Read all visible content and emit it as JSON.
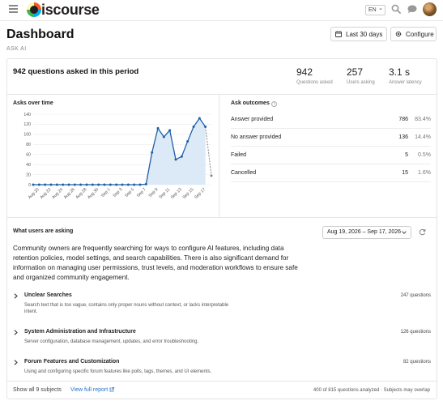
{
  "header": {
    "logo_text": "iscourse",
    "language": "EN"
  },
  "page": {
    "title": "Dashboard",
    "subtitle": "ASK AI",
    "period_button": "Last 30 days",
    "config_button": "Configure"
  },
  "overview": {
    "heading": "942 questions asked in this period",
    "stats": [
      {
        "value": "942",
        "label": "Questions asked"
      },
      {
        "value": "257",
        "label": "Users asking"
      },
      {
        "value": "3.1 s",
        "label": "Answer latency"
      }
    ]
  },
  "asks_over_time": {
    "title": "Asks over time"
  },
  "chart_data": {
    "type": "line",
    "title": "Asks over time",
    "xlabel": "",
    "ylabel": "",
    "ylim": [
      0,
      140
    ],
    "yticks": [
      0,
      20,
      40,
      60,
      80,
      100,
      120,
      140
    ],
    "x_tick_labels": [
      "Aug 20",
      "Aug 22",
      "Aug 24",
      "Aug 26",
      "Aug 28",
      "Aug 30",
      "Sep 1",
      "Sep 3",
      "Sep 5",
      "Sep 7",
      "Sep 9",
      "Sep 11",
      "Sep 13",
      "Sep 15",
      "Sep 17"
    ],
    "grid": true,
    "series": [
      {
        "points": [
          [
            "Aug 19",
            0
          ],
          [
            "Aug 20",
            0
          ],
          [
            "Aug 21",
            0
          ],
          [
            "Aug 22",
            0
          ],
          [
            "Aug 23",
            0
          ],
          [
            "Aug 24",
            0
          ],
          [
            "Aug 25",
            0
          ],
          [
            "Aug 26",
            0
          ],
          [
            "Aug 27",
            0
          ],
          [
            "Aug 28",
            0
          ],
          [
            "Aug 29",
            0
          ],
          [
            "Aug 30",
            0
          ],
          [
            "Aug 31",
            0
          ],
          [
            "Sep 1",
            0
          ],
          [
            "Sep 2",
            0
          ],
          [
            "Sep 3",
            0
          ],
          [
            "Sep 4",
            0
          ],
          [
            "Sep 5",
            0
          ],
          [
            "Sep 6",
            0
          ],
          [
            "Sep 7",
            1
          ],
          [
            "Sep 8",
            64
          ],
          [
            "Sep 9",
            112
          ],
          [
            "Sep 10",
            95
          ],
          [
            "Sep 11",
            108
          ],
          [
            "Sep 12",
            50
          ],
          [
            "Sep 13",
            56
          ],
          [
            "Sep 14",
            86
          ],
          [
            "Sep 15",
            115
          ],
          [
            "Sep 16",
            132
          ],
          [
            "Sep 17",
            115
          ],
          [
            "Sep 18",
            18
          ]
        ],
        "last_point_partial": true
      }
    ]
  },
  "outcomes": {
    "title": "Ask outcomes",
    "rows": [
      {
        "label": "Answer provided",
        "count": "786",
        "pct": "83.4%"
      },
      {
        "label": "No answer provided",
        "count": "136",
        "pct": "14.4%"
      },
      {
        "label": "Failed",
        "count": "5",
        "pct": "0.5%"
      },
      {
        "label": "Cancelled",
        "count": "15",
        "pct": "1.6%"
      }
    ]
  },
  "asking": {
    "title": "What users are asking",
    "date_range": "Aug 19, 2026 – Sep 17, 2026",
    "summary": "Community owners are frequently searching for ways to configure AI features, including data retention policies, model settings, and search capabilities. There is also significant demand for information on managing user permissions, trust levels, and moderation workflows to ensure safe and organized community engagement.",
    "subjects": [
      {
        "title": "Unclear Searches",
        "desc": "Search text that is too vague, contains only proper nouns without context, or lacks interpretable intent.",
        "count": "247 questions"
      },
      {
        "title": "System Administration and Infrastructure",
        "desc": "Server configuration, database management, updates, and error troubleshooting.",
        "count": "126 questions"
      },
      {
        "title": "Forum Features and Customization",
        "desc": "Using and configuring specific forum features like polls, tags, themes, and UI elements.",
        "count": "82 questions"
      }
    ],
    "show_all": "Show all 9 subjects",
    "view_report": "View full report",
    "analyzed_note": "400 of 815 questions analyzed · Subjects may overlap"
  },
  "colors": {
    "line": "#1f5fa8",
    "fill": "#dce9f6",
    "link": "#2870c6"
  }
}
